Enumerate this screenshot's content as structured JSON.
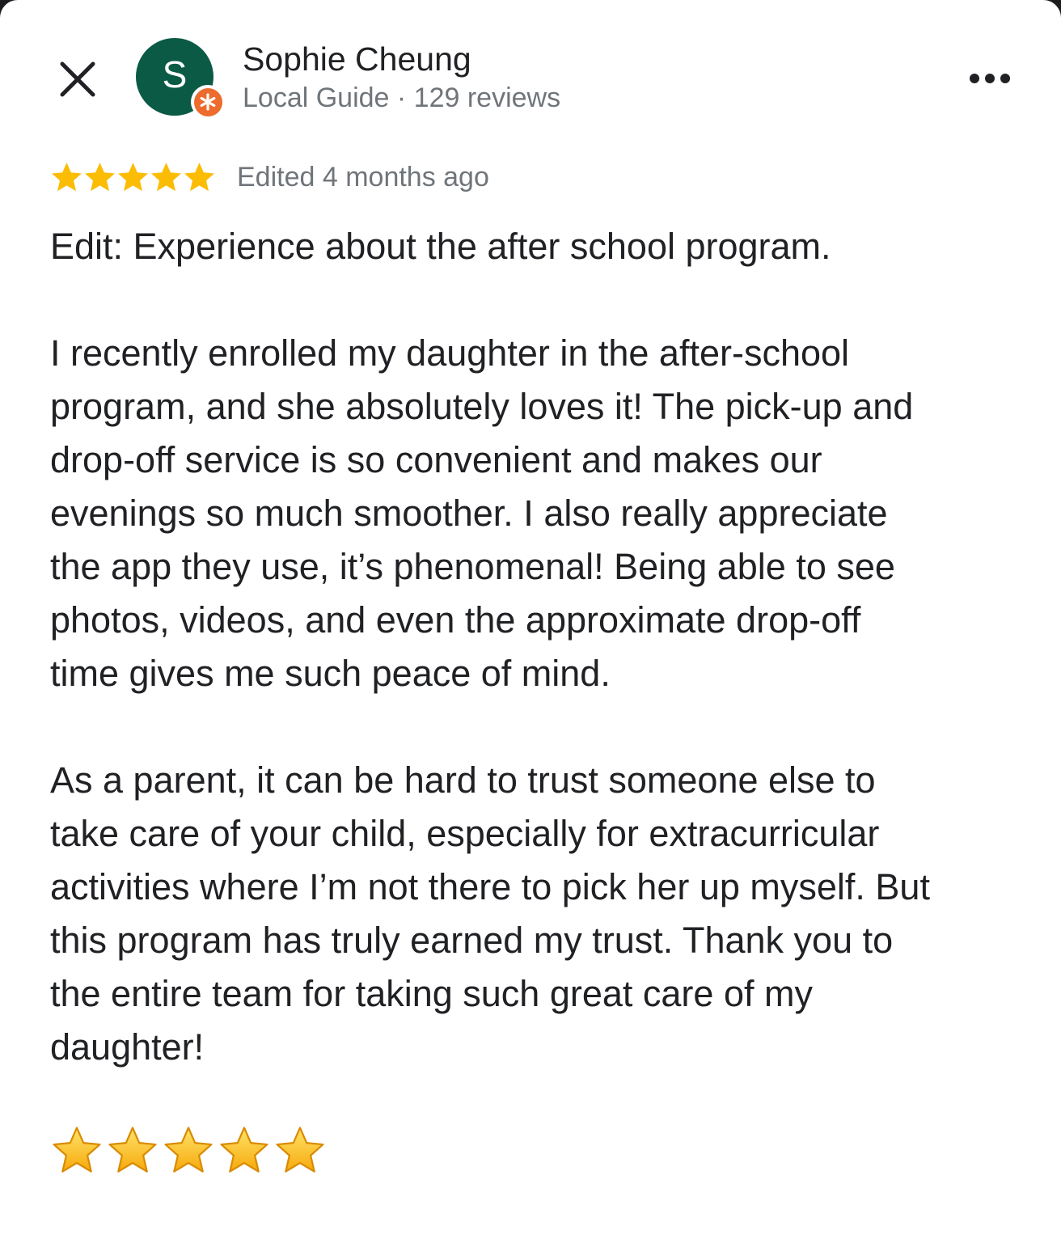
{
  "header": {
    "close_icon": "close-icon",
    "more_icon": "more-horizontal-icon"
  },
  "author": {
    "initial": "S",
    "name": "Sophie Cheung",
    "meta": "Local Guide · 129 reviews",
    "avatar_color": "#0b5a45",
    "badge_color": "#ec6b2d",
    "badge_icon": "local-guide-star-icon"
  },
  "review": {
    "rating": 5,
    "max_rating": 5,
    "star_color": "#fbbc04",
    "date": "Edited 4 months ago",
    "paragraphs": [
      "Edit: Experience about the after school program.",
      "I recently enrolled my daughter in the after-school\nprogram, and she absolutely loves it! The pick-up and\ndrop-off service is so convenient and makes our\nevenings so much smoother. I also really appreciate\nthe app they use, it’s phenomenal! Being able to see\nphotos, videos, and even the approximate drop-off\ntime gives me such peace of mind.",
      "As a parent, it can be hard to trust someone else to\ntake care of your child, especially for extracurricular\nactivities where I’m not there to pick her up myself. But\nthis program has truly earned my trust. Thank you to\nthe entire team for taking such great care of my\ndaughter!"
    ],
    "emoji_star_count": 5,
    "emoji_star_icon": "star-emoji-icon"
  }
}
